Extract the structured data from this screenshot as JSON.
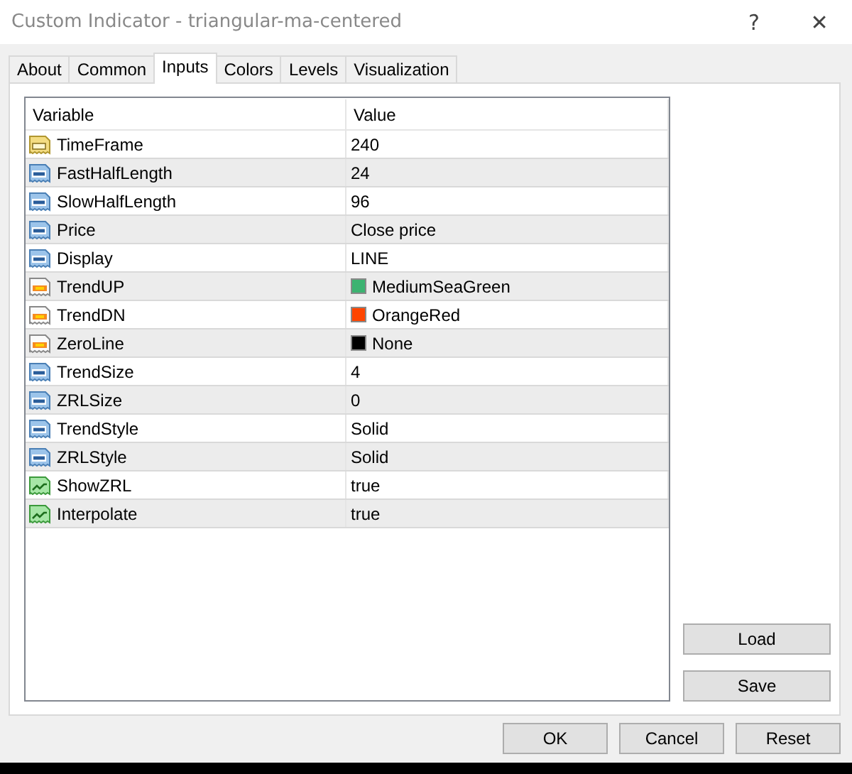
{
  "window": {
    "title": "Custom Indicator - triangular-ma-centered",
    "help": "?",
    "close": "✕"
  },
  "tabs": [
    {
      "label": "About",
      "selected": false
    },
    {
      "label": "Common",
      "selected": false
    },
    {
      "label": "Inputs",
      "selected": true
    },
    {
      "label": "Colors",
      "selected": false
    },
    {
      "label": "Levels",
      "selected": false
    },
    {
      "label": "Visualization",
      "selected": false
    }
  ],
  "table": {
    "columns": [
      "Variable",
      "Value"
    ],
    "rows": [
      {
        "kind": "string",
        "name": "TimeFrame",
        "value": "240"
      },
      {
        "kind": "number",
        "name": "FastHalfLength",
        "value": "24"
      },
      {
        "kind": "number",
        "name": "SlowHalfLength",
        "value": "96"
      },
      {
        "kind": "number",
        "name": "Price",
        "value": "Close price"
      },
      {
        "kind": "number",
        "name": "Display",
        "value": "LINE"
      },
      {
        "kind": "color",
        "name": "TrendUP",
        "value": "MediumSeaGreen",
        "color": "#3cb371"
      },
      {
        "kind": "color",
        "name": "TrendDN",
        "value": "OrangeRed",
        "color": "#ff4500"
      },
      {
        "kind": "color",
        "name": "ZeroLine",
        "value": "None",
        "color": "#000000"
      },
      {
        "kind": "number",
        "name": "TrendSize",
        "value": "4"
      },
      {
        "kind": "number",
        "name": "ZRLSize",
        "value": "0"
      },
      {
        "kind": "number",
        "name": "TrendStyle",
        "value": "Solid"
      },
      {
        "kind": "number",
        "name": "ZRLStyle",
        "value": "Solid"
      },
      {
        "kind": "bool",
        "name": "ShowZRL",
        "value": "true"
      },
      {
        "kind": "bool",
        "name": "Interpolate",
        "value": "true"
      }
    ]
  },
  "side_buttons": [
    "Load",
    "Save"
  ],
  "buttons": [
    "OK",
    "Cancel",
    "Reset"
  ]
}
